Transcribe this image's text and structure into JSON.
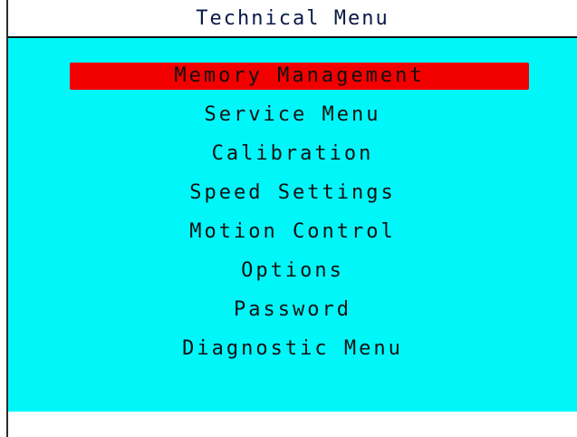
{
  "header": {
    "title": "Technical Menu"
  },
  "menu": {
    "selected_index": 0,
    "items": [
      {
        "label": "Memory Management"
      },
      {
        "label": "Service Menu"
      },
      {
        "label": "Calibration"
      },
      {
        "label": "Speed Settings"
      },
      {
        "label": "Motion Control"
      },
      {
        "label": "Options"
      },
      {
        "label": "Password"
      },
      {
        "label": "Diagnostic Menu"
      }
    ]
  },
  "colors": {
    "background": "#00f7fa",
    "selection": "#f20000",
    "title_text": "#0a1a48",
    "item_text": "#111111"
  }
}
